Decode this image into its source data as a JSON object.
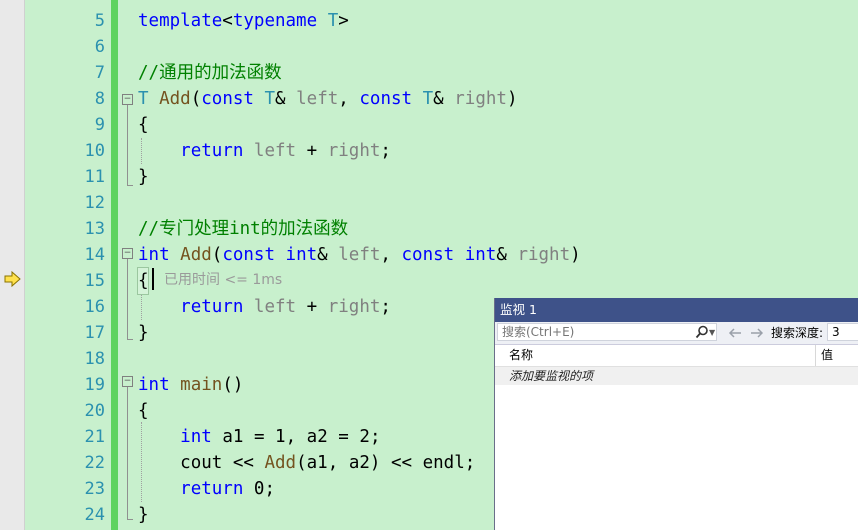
{
  "editor": {
    "line_numbers": [
      "5",
      "6",
      "7",
      "8",
      "9",
      "10",
      "11",
      "12",
      "13",
      "14",
      "15",
      "16",
      "17",
      "18",
      "19",
      "20",
      "21",
      "22",
      "23",
      "24"
    ],
    "perf_tip": "已用时间 <= 1ms",
    "tokens": {
      "template": "template",
      "typename": "typename",
      "T": "T",
      "lt": "<",
      "gt": ">",
      "comment1": "//通用的加法函数",
      "comment2": "//专门处理int的加法函数",
      "Add": "Add",
      "const": "const",
      "int": "int",
      "amp": "&",
      "left": "left",
      "right": "right",
      "return": "return",
      "plus": "+",
      "main": "main",
      "a1": "a1",
      "a2": "a2",
      "cout": "cout",
      "endl": "endl",
      "zero": "0",
      "one": "1",
      "two": "2",
      "lbrace": "{",
      "rbrace": "}",
      "lparen": "(",
      "rparen": ")",
      "comma": ",",
      "semi": ";",
      "eq": "=",
      "shl": "<<"
    }
  },
  "watch": {
    "title": "监视 1",
    "search_placeholder": "搜索(Ctrl+E)",
    "depth_label": "搜索深度:",
    "depth_value": "3",
    "col_name": "名称",
    "col_value": "值",
    "add_item": "添加要监视的项"
  }
}
